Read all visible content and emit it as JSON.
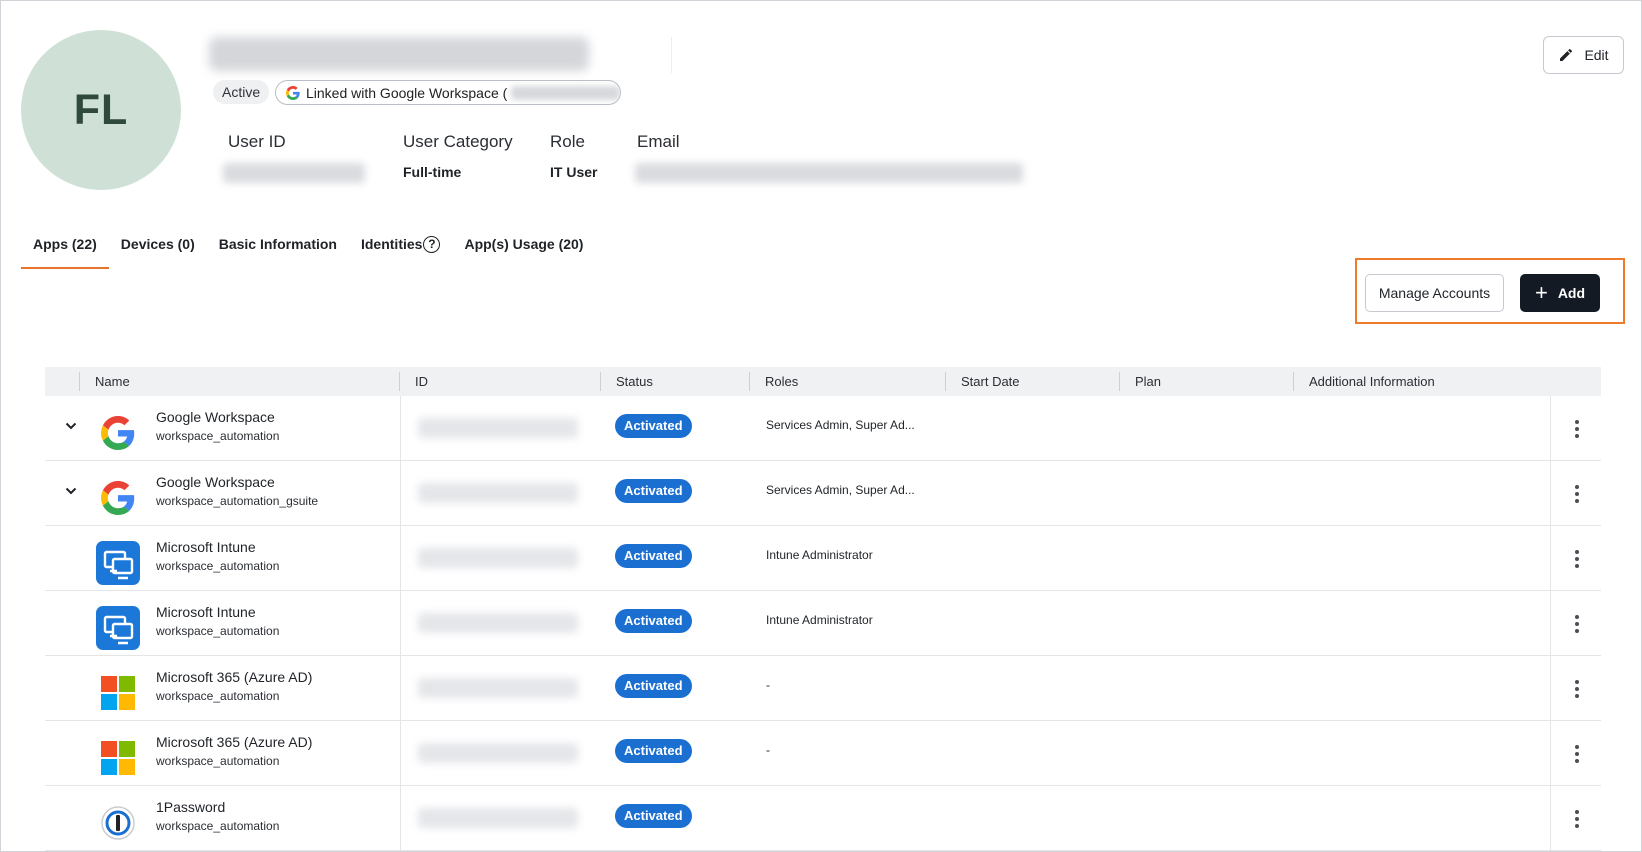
{
  "profile": {
    "initials": "FL",
    "status": "Active",
    "linked_label": "Linked with Google Workspace (",
    "fields": [
      {
        "label": "User ID",
        "value": ""
      },
      {
        "label": "User Category",
        "value": "Full-time"
      },
      {
        "label": "Role",
        "value": "IT User"
      },
      {
        "label": "Email",
        "value": ""
      }
    ],
    "edit_label": "Edit"
  },
  "tabs": [
    {
      "label": "Apps (22)",
      "active": true
    },
    {
      "label": "Devices (0)",
      "active": false
    },
    {
      "label": "Basic Information",
      "active": false
    },
    {
      "label": "Identities",
      "active": false,
      "icon": "help-circle-icon"
    },
    {
      "label": "App(s) Usage (20)",
      "active": false
    }
  ],
  "actions": {
    "manage_label": "Manage Accounts",
    "add_label": "Add",
    "highlight_color": "#ee7b2b"
  },
  "table": {
    "columns": [
      "Name",
      "ID",
      "Status",
      "Roles",
      "Start Date",
      "Plan",
      "Additional Information"
    ],
    "rows": [
      {
        "icon": "google-icon",
        "expandable": true,
        "name": "Google Workspace",
        "sub": "workspace_automation",
        "status": "Activated",
        "roles": "Services Admin, Super Ad..."
      },
      {
        "icon": "google-icon",
        "expandable": true,
        "name": "Google Workspace",
        "sub": "workspace_automation_gsuite",
        "status": "Activated",
        "roles": "Services Admin, Super Ad..."
      },
      {
        "icon": "intune-icon",
        "expandable": false,
        "name": "Microsoft Intune",
        "sub": "workspace_automation",
        "status": "Activated",
        "roles": "Intune Administrator"
      },
      {
        "icon": "intune-icon",
        "expandable": false,
        "name": "Microsoft Intune",
        "sub": "workspace_automation",
        "status": "Activated",
        "roles": "Intune Administrator"
      },
      {
        "icon": "microsoft-icon",
        "expandable": false,
        "name": "Microsoft 365 (Azure AD)",
        "sub": "workspace_automation",
        "status": "Activated",
        "roles": "-"
      },
      {
        "icon": "microsoft-icon",
        "expandable": false,
        "name": "Microsoft 365 (Azure AD)",
        "sub": "workspace_automation",
        "status": "Activated",
        "roles": "-"
      },
      {
        "icon": "1password-icon",
        "expandable": false,
        "name": "1Password",
        "sub": "workspace_automation",
        "status": "Activated",
        "roles": ""
      }
    ]
  },
  "colors": {
    "avatar_bg": "#cfe1d6",
    "active_tab_underline": "#e8732a",
    "status_badge": "#1a6fd1",
    "add_button": "#141a24"
  }
}
